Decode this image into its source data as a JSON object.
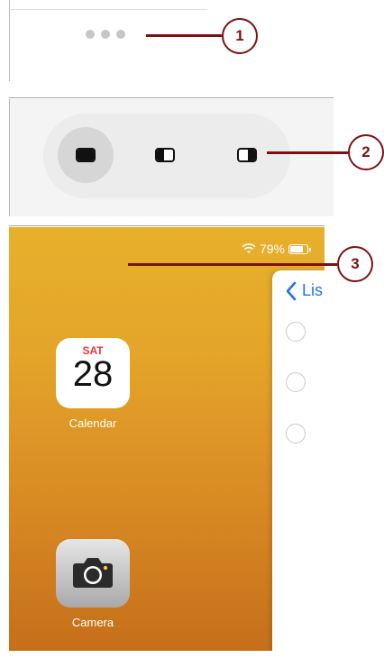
{
  "panel1": {
    "menu_icon": "ellipsis-dots-icon"
  },
  "panel2": {
    "buttons": [
      {
        "icon": "full-screen-icon"
      },
      {
        "icon": "split-view-icon"
      },
      {
        "icon": "slide-over-icon"
      }
    ]
  },
  "panel3": {
    "status": {
      "battery_percent": "79%",
      "wifi_icon": "wifi-icon",
      "battery_level": 0.79
    },
    "slideover": {
      "back_text": "Lis"
    },
    "apps": [
      {
        "name": "Calendar",
        "day": "SAT",
        "date": "28"
      },
      {
        "name": "Camera"
      }
    ]
  },
  "callouts": [
    "1",
    "2",
    "3"
  ],
  "colors": {
    "callout": "#7b1113",
    "accent_blue": "#1f74e8"
  }
}
